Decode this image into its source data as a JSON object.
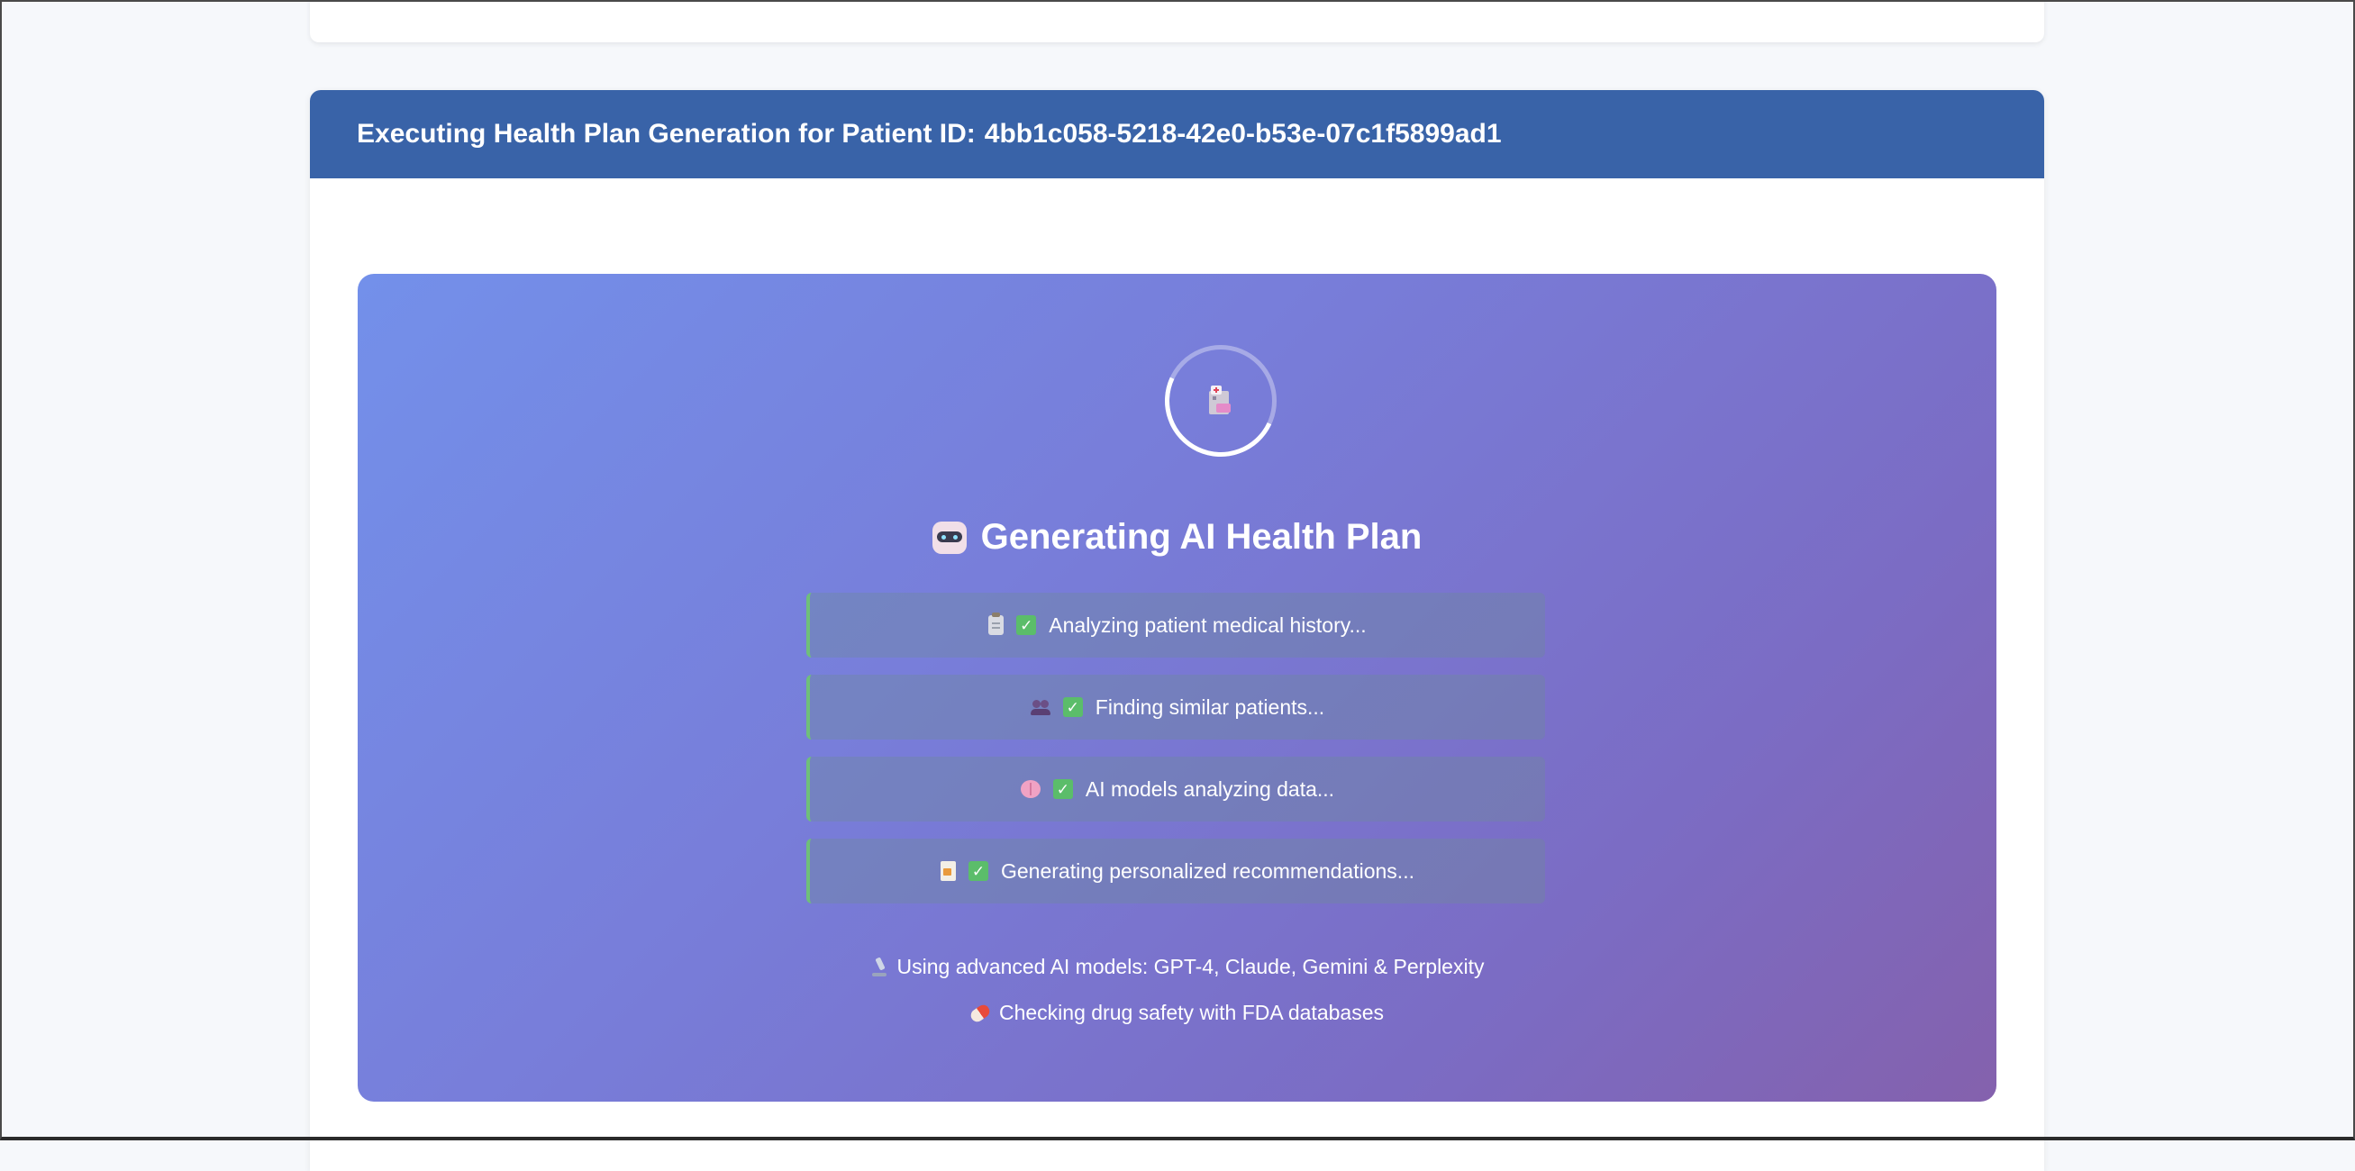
{
  "header": {
    "title_prefix": "Executing Health Plan Generation for Patient ID:",
    "patient_id": "4bb1c058-5218-42e0-b53e-07c1f5899ad1"
  },
  "generator": {
    "title": "Generating AI Health Plan",
    "title_icon": "robot-icon",
    "spinner_icon": "hospital-icon",
    "steps": [
      {
        "icon": "clipboard-icon",
        "status": "✓",
        "label": "Analyzing patient medical history..."
      },
      {
        "icon": "users-icon",
        "status": "✓",
        "label": "Finding similar patients..."
      },
      {
        "icon": "brain-icon",
        "status": "✓",
        "label": "AI models analyzing data..."
      },
      {
        "icon": "document-icon",
        "status": "✓",
        "label": "Generating personalized recommendations..."
      }
    ],
    "footer": [
      {
        "icon": "microscope-icon",
        "text": "Using advanced AI models: GPT-4, Claude, Gemini & Perplexity"
      },
      {
        "icon": "pill-icon",
        "text": "Checking drug safety with FDA databases"
      }
    ]
  },
  "colors": {
    "header_bg": "#3963a8",
    "gradient_start": "#7390ea",
    "gradient_end": "#8461ad",
    "check_green": "#5bbd6a"
  }
}
